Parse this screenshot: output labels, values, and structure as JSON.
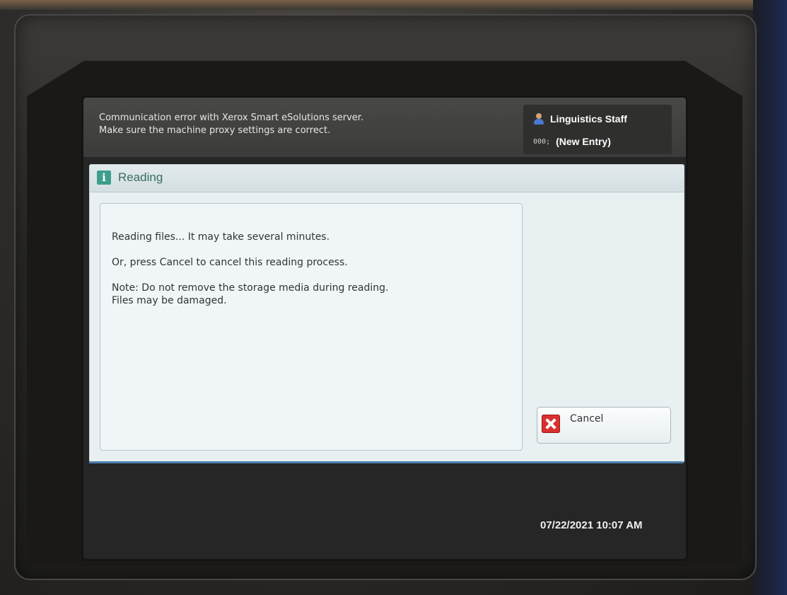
{
  "system_message": {
    "line1": "Communication error with Xerox Smart eSolutions server.",
    "line2": "Make sure the machine proxy settings are correct."
  },
  "user": {
    "name": "Linguistics Staff",
    "account_icon": "000;",
    "account_label": "(New Entry)"
  },
  "dialog": {
    "title": "Reading",
    "paragraphs": [
      "Reading files... It may take several minutes.",
      "Or, press Cancel to cancel this reading process."
    ],
    "note_line1": "Note: Do not remove the storage media during reading.",
    "note_line2": "Files may be damaged.",
    "cancel_label": "Cancel"
  },
  "status": {
    "datetime": "07/22/2021  10:07 AM"
  },
  "colors": {
    "dialog_bg": "#e8f0f2",
    "title_color": "#3a6f62",
    "info_icon_bg": "#3e9e8c",
    "cancel_icon_bg": "#d83030",
    "accent_strip": "#4d7fb0"
  }
}
